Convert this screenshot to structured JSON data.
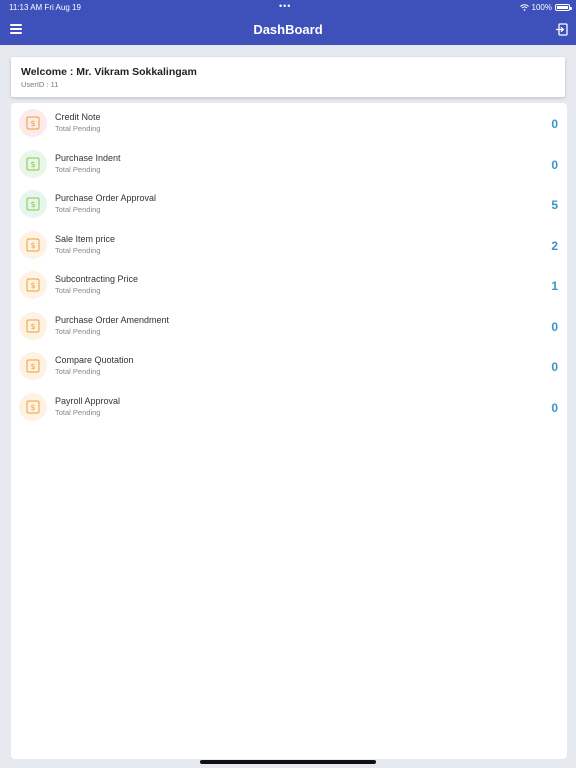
{
  "status_bar": {
    "time_date": "11:13 AM   Fri Aug 19",
    "dots": "•••",
    "battery_text": "100%"
  },
  "header": {
    "title": "DashBoard"
  },
  "welcome": {
    "greeting": "Welcome : Mr. Vikram Sokkalingam",
    "user_id": "UserID : 11"
  },
  "items": [
    {
      "label": "Credit Note",
      "sub": "Total Pending",
      "count": "0",
      "icon": "dollar-exchange-icon",
      "icon_bg": "#fdeaea",
      "icon_color": "#f0a030"
    },
    {
      "label": "Purchase Indent",
      "sub": "Total Pending",
      "count": "0",
      "icon": "dollar-exchange-icon",
      "icon_bg": "#e9f7ea",
      "icon_color": "#8cc63f"
    },
    {
      "label": "Purchase Order Approval",
      "sub": "Total Pending",
      "count": "5",
      "icon": "dollar-exchange-icon",
      "icon_bg": "#e6f6ef",
      "icon_color": "#8cc63f"
    },
    {
      "label": "Sale Item price",
      "sub": "Total Pending",
      "count": "2",
      "icon": "dollar-exchange-icon",
      "icon_bg": "#fdf2e4",
      "icon_color": "#f0a030"
    },
    {
      "label": "Subcontracting Price",
      "sub": "Total Pending",
      "count": "1",
      "icon": "dollar-exchange-icon",
      "icon_bg": "#fdf2e4",
      "icon_color": "#f0a030"
    },
    {
      "label": "Purchase Order Amendment",
      "sub": "Total Pending",
      "count": "0",
      "icon": "dollar-exchange-icon",
      "icon_bg": "#fdf2e4",
      "icon_color": "#f0a030"
    },
    {
      "label": "Compare Quotation",
      "sub": "Total Pending",
      "count": "0",
      "icon": "dollar-exchange-icon",
      "icon_bg": "#fdf2e4",
      "icon_color": "#f0a030"
    },
    {
      "label": "Payroll Approval",
      "sub": "Total Pending",
      "count": "0",
      "icon": "dollar-exchange-icon",
      "icon_bg": "#fdf2e4",
      "icon_color": "#f0a030"
    }
  ],
  "colors": {
    "header_bg": "#3e51bb",
    "count_color": "#3a93c9"
  }
}
